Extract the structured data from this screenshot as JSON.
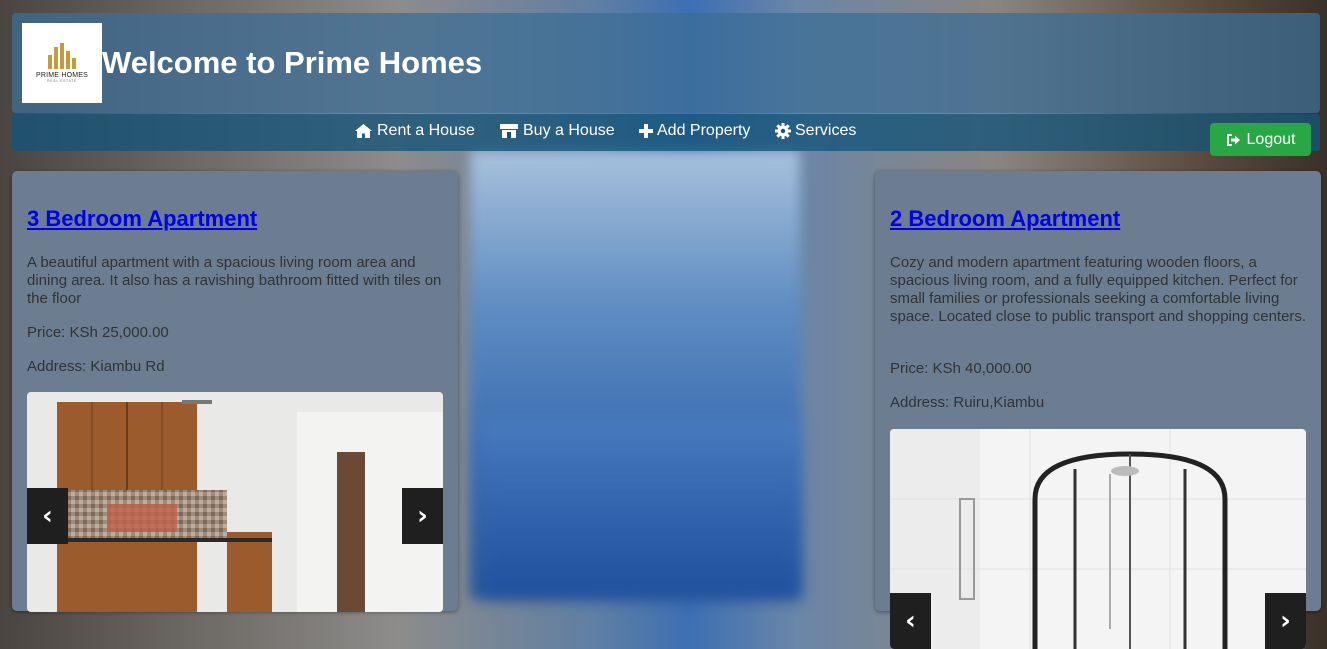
{
  "header": {
    "logo": {
      "icon": "building-logo-icon",
      "name": "PRIME HOMES",
      "tagline": "REAL ESTATE"
    },
    "title": "Welcome to Prime Homes"
  },
  "nav": {
    "items": [
      {
        "label": "Rent a House",
        "icon": "home-icon"
      },
      {
        "label": "Buy a House",
        "icon": "store-icon"
      },
      {
        "label": "Add Property",
        "icon": "plus-icon"
      },
      {
        "label": "Services",
        "icon": "gear-icon"
      }
    ],
    "logout_label": "Logout",
    "logout_icon": "sign-out-icon",
    "logout_color": "#28a745"
  },
  "listings": [
    {
      "title": "3 Bedroom Apartment",
      "description": "A beautiful apartment with a spacious living room area and dining area. It also has a ravishing bathroom fitted with tiles on the floor",
      "price": "Price: KSh 25,000.00",
      "address": "Address: Kiambu Rd",
      "image": "kitchen-photo",
      "prev_label": "‹",
      "next_label": "›"
    },
    {
      "title": "2 Bedroom Apartment",
      "description": "Cozy and modern apartment featuring wooden floors, a spacious living room, and a fully equipped kitchen. Perfect for small families or professionals seeking a comfortable living space. Located close to public transport and shopping centers.",
      "price": "Price: KSh 40,000.00",
      "address": "Address: Ruiru,Kiambu",
      "image": "shower-photo",
      "prev_label": "‹",
      "next_label": "›"
    }
  ],
  "colors": {
    "header_bg": "#3c6e96",
    "nav_bg": "#145578",
    "card_bg": "#6d7d91",
    "link": "#0000ee"
  }
}
